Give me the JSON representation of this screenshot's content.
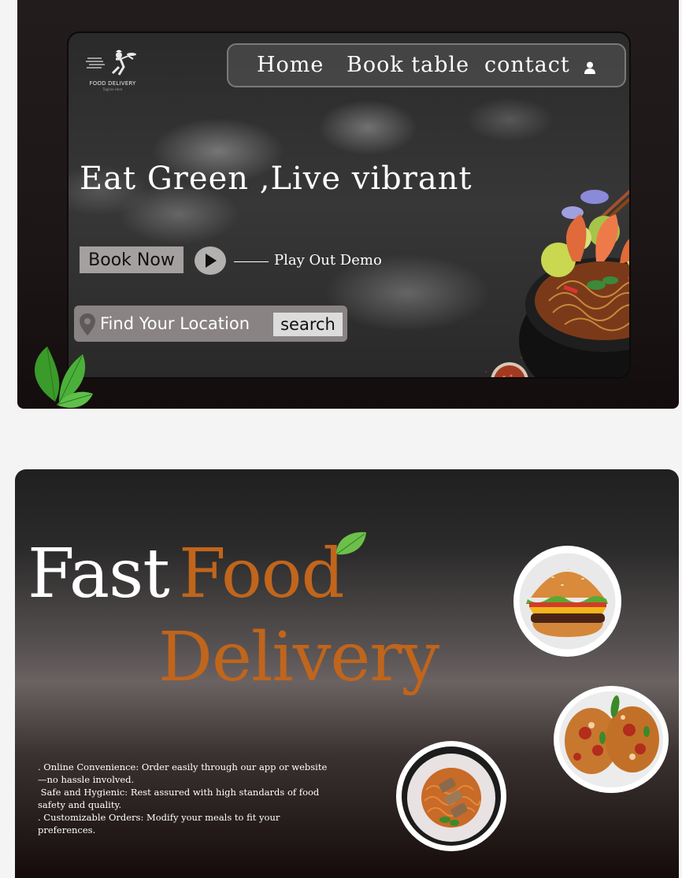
{
  "hero": {
    "logo": {
      "name": "FOOD DELIVERY",
      "tagline": "Tagline Here",
      "icon": "chef-runner-icon"
    },
    "nav": {
      "items": [
        {
          "label": "Home"
        },
        {
          "label": "Book table"
        },
        {
          "label": "contact"
        }
      ],
      "user_icon": "user-icon"
    },
    "headline": "Eat Green ,Live vibrant",
    "book_button": "Book Now",
    "demo_label": "Play Out Demo",
    "search": {
      "placeholder": "Find Your Location",
      "button": "search",
      "icon": "map-pin-icon"
    },
    "images": [
      "noodle-bowl",
      "spice-bowl",
      "mint-leaves"
    ]
  },
  "delivery": {
    "title_word1": "Fast",
    "title_word2": "Food",
    "title_word3": "Delivery",
    "features": [
      ". Online Convenience: Order easily through our app or website—no hassle involved.",
      " Safe and Hygienic: Rest assured with high standards of food safety and quality.",
      ". Customizable Orders: Modify your meals to fit your preferences."
    ],
    "images": [
      "burger",
      "chicken-parmesan",
      "spaghetti"
    ]
  },
  "colors": {
    "accent_orange": "#c0651c",
    "nav_border": "#7a7a7a",
    "button_gray": "#a5a0a0",
    "text_white": "#ffffff"
  }
}
